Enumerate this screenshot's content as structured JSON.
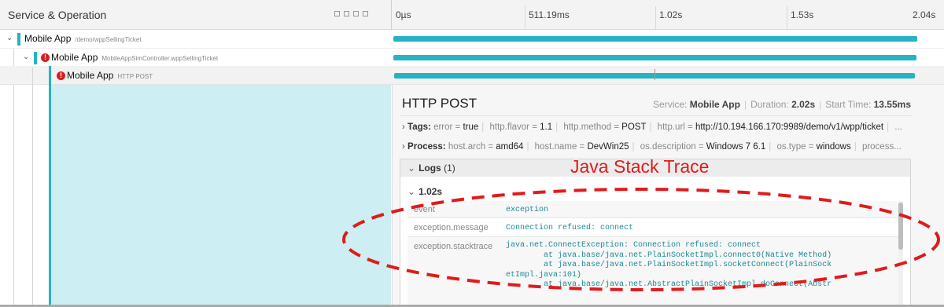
{
  "header": {
    "column_title": "Service & Operation",
    "ticks": [
      "0µs",
      "511.19ms",
      "1.02s",
      "1.53s",
      "2.04s"
    ]
  },
  "rows": [
    {
      "service": "Mobile App",
      "operation": "/demo/wppSellingTicket",
      "error": false,
      "bar_start": 0.0,
      "bar_end": 1.0
    },
    {
      "service": "Mobile App",
      "operation": "MobileAppSimController.wppSellingTicket",
      "error": true,
      "bar_start": 0.0,
      "bar_end": 0.998
    },
    {
      "service": "Mobile App",
      "operation": "HTTP POST",
      "error": true,
      "bar_start": 0.002,
      "bar_end": 0.995
    }
  ],
  "detail": {
    "title": "HTTP POST",
    "service_label": "Service:",
    "service_value": "Mobile App",
    "duration_label": "Duration:",
    "duration_value": "2.02s",
    "start_label": "Start Time:",
    "start_value": "13.55ms",
    "tags_label": "Tags:",
    "tags": [
      {
        "k": "error",
        "v": "true"
      },
      {
        "k": "http.flavor",
        "v": "1.1"
      },
      {
        "k": "http.method",
        "v": "POST"
      },
      {
        "k": "http.url",
        "v": "http://10.194.166.170:9989/demo/v1/wpp/ticket"
      }
    ],
    "tags_more": "...",
    "process_label": "Process:",
    "process": [
      {
        "k": "host.arch",
        "v": "amd64"
      },
      {
        "k": "host.name",
        "v": "DevWin25"
      },
      {
        "k": "os.description",
        "v": "Windows 7 6.1"
      },
      {
        "k": "os.type",
        "v": "windows"
      }
    ],
    "process_more": "process...",
    "logs_label": "Logs",
    "logs_count": "(1)",
    "log_time": "1.02s",
    "log_fields": [
      {
        "key": "event",
        "value": "exception"
      },
      {
        "key": "exception.message",
        "value": "Connection refused: connect"
      },
      {
        "key": "exception.stacktrace",
        "value": "java.net.ConnectException: Connection refused: connect\n        at java.base/java.net.PlainSocketImpl.connect0(Native Method)\n        at java.base/java.net.PlainSocketImpl.socketConnect(PlainSock\netImpl.java:101)\n        at java.base/java.net.AbstractPlainSocketImpl.doConnect(Abstr"
      }
    ]
  },
  "annotation": {
    "label": "Java Stack Trace",
    "color": "#e01b1b"
  },
  "colors": {
    "accent": "#26b3c2",
    "error": "#d61f1f"
  },
  "icons": {
    "expand": "chevron-down-icon",
    "collapse": "chevron-right-icon",
    "error": "error-icon"
  }
}
